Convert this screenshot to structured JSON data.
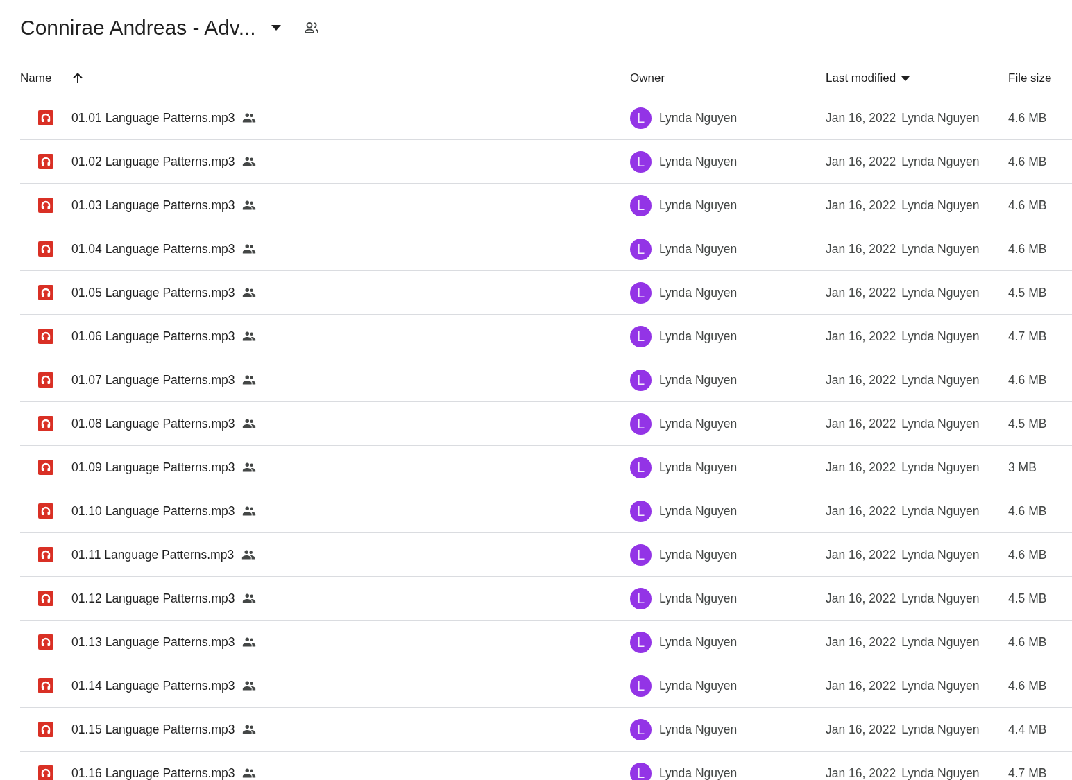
{
  "folder": {
    "title": "Connirae Andreas - Adv..."
  },
  "table": {
    "columns": [
      {
        "label": "Name"
      },
      {
        "label": "Owner"
      },
      {
        "label": "Last modified"
      },
      {
        "label": "File size"
      }
    ],
    "rows": [
      {
        "name": "01.01 Language Patterns.mp3",
        "avatar": "L",
        "owner": "Lynda Nguyen",
        "modified": "Jan 16, 2022",
        "modified_by": "Lynda Nguyen",
        "size": "4.6 MB"
      },
      {
        "name": "01.02 Language Patterns.mp3",
        "avatar": "L",
        "owner": "Lynda Nguyen",
        "modified": "Jan 16, 2022",
        "modified_by": "Lynda Nguyen",
        "size": "4.6 MB"
      },
      {
        "name": "01.03 Language Patterns.mp3",
        "avatar": "L",
        "owner": "Lynda Nguyen",
        "modified": "Jan 16, 2022",
        "modified_by": "Lynda Nguyen",
        "size": "4.6 MB"
      },
      {
        "name": "01.04 Language Patterns.mp3",
        "avatar": "L",
        "owner": "Lynda Nguyen",
        "modified": "Jan 16, 2022",
        "modified_by": "Lynda Nguyen",
        "size": "4.6 MB"
      },
      {
        "name": "01.05 Language Patterns.mp3",
        "avatar": "L",
        "owner": "Lynda Nguyen",
        "modified": "Jan 16, 2022",
        "modified_by": "Lynda Nguyen",
        "size": "4.5 MB"
      },
      {
        "name": "01.06 Language Patterns.mp3",
        "avatar": "L",
        "owner": "Lynda Nguyen",
        "modified": "Jan 16, 2022",
        "modified_by": "Lynda Nguyen",
        "size": "4.7 MB"
      },
      {
        "name": "01.07 Language Patterns.mp3",
        "avatar": "L",
        "owner": "Lynda Nguyen",
        "modified": "Jan 16, 2022",
        "modified_by": "Lynda Nguyen",
        "size": "4.6 MB"
      },
      {
        "name": "01.08 Language Patterns.mp3",
        "avatar": "L",
        "owner": "Lynda Nguyen",
        "modified": "Jan 16, 2022",
        "modified_by": "Lynda Nguyen",
        "size": "4.5 MB"
      },
      {
        "name": "01.09 Language Patterns.mp3",
        "avatar": "L",
        "owner": "Lynda Nguyen",
        "modified": "Jan 16, 2022",
        "modified_by": "Lynda Nguyen",
        "size": "3 MB"
      },
      {
        "name": "01.10 Language Patterns.mp3",
        "avatar": "L",
        "owner": "Lynda Nguyen",
        "modified": "Jan 16, 2022",
        "modified_by": "Lynda Nguyen",
        "size": "4.6 MB"
      },
      {
        "name": "01.11 Language Patterns.mp3",
        "avatar": "L",
        "owner": "Lynda Nguyen",
        "modified": "Jan 16, 2022",
        "modified_by": "Lynda Nguyen",
        "size": "4.6 MB"
      },
      {
        "name": "01.12 Language Patterns.mp3",
        "avatar": "L",
        "owner": "Lynda Nguyen",
        "modified": "Jan 16, 2022",
        "modified_by": "Lynda Nguyen",
        "size": "4.5 MB"
      },
      {
        "name": "01.13 Language Patterns.mp3",
        "avatar": "L",
        "owner": "Lynda Nguyen",
        "modified": "Jan 16, 2022",
        "modified_by": "Lynda Nguyen",
        "size": "4.6 MB"
      },
      {
        "name": "01.14 Language Patterns.mp3",
        "avatar": "L",
        "owner": "Lynda Nguyen",
        "modified": "Jan 16, 2022",
        "modified_by": "Lynda Nguyen",
        "size": "4.6 MB"
      },
      {
        "name": "01.15 Language Patterns.mp3",
        "avatar": "L",
        "owner": "Lynda Nguyen",
        "modified": "Jan 16, 2022",
        "modified_by": "Lynda Nguyen",
        "size": "4.4 MB"
      },
      {
        "name": "01.16 Language Patterns.mp3",
        "avatar": "L",
        "owner": "Lynda Nguyen",
        "modified": "Jan 16, 2022",
        "modified_by": "Lynda Nguyen",
        "size": "4.7 MB"
      }
    ]
  }
}
